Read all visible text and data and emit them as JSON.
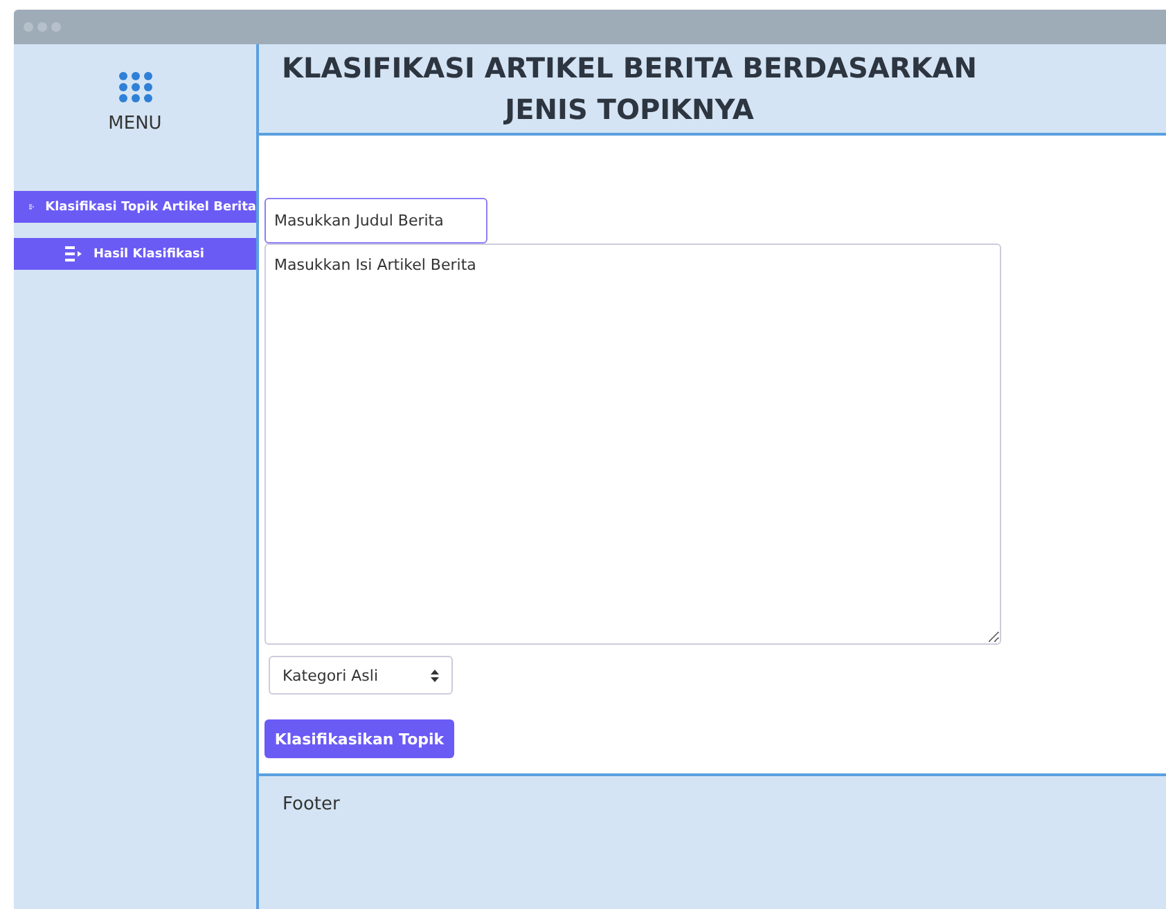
{
  "sidebar": {
    "menu_label": "MENU",
    "items": [
      {
        "label": "Klasifikasi Topik Artikel Berita"
      },
      {
        "label": "Hasil Klasifikasi"
      }
    ]
  },
  "header": {
    "title": "KLASIFIKASI ARTIKEL BERITA BERDASARKAN JENIS TOPIKNYA"
  },
  "form": {
    "title_field": {
      "placeholder": "Masukkan Judul Berita"
    },
    "body_field": {
      "placeholder": "Masukkan Isi Artikel Berita"
    },
    "category_select": {
      "value": "Kategori Asli"
    },
    "submit_button": "Klasifikasikan Topik"
  },
  "footer": {
    "text": "Footer"
  }
}
